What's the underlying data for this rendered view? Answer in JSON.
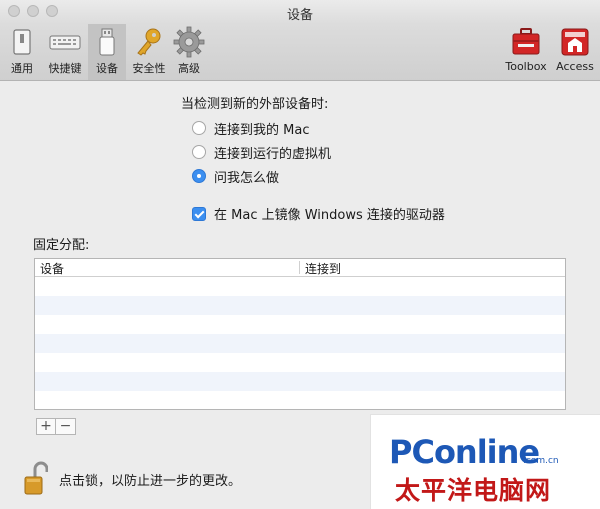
{
  "window": {
    "title": "设备"
  },
  "toolbar": {
    "items": [
      {
        "label": "通用",
        "icon": "general-switch-icon"
      },
      {
        "label": "快捷键",
        "icon": "keyboard-icon"
      },
      {
        "label": "设备",
        "icon": "usb-device-icon",
        "selected": true
      },
      {
        "label": "安全性",
        "icon": "key-icon"
      },
      {
        "label": "高级",
        "icon": "gear-icon"
      }
    ],
    "right_items": [
      {
        "label": "Toolbox",
        "icon": "toolbox-icon"
      },
      {
        "label": "Access",
        "icon": "access-icon"
      }
    ]
  },
  "content": {
    "heading": "当检测到新的外部设备时:",
    "radio_options": [
      {
        "label": "连接到我的 Mac",
        "checked": false
      },
      {
        "label": "连接到运行的虚拟机",
        "checked": false
      },
      {
        "label": "问我怎么做",
        "checked": true
      }
    ],
    "mirror_checkbox": {
      "label": "在 Mac 上镜像 Windows 连接的驱动器",
      "checked": true
    },
    "fixed_assign_label": "固定分配:",
    "table": {
      "columns": [
        "设备",
        "连接到"
      ],
      "rows": []
    },
    "add_button": "+",
    "remove_button": "−",
    "lock_text": "点击锁，以防止进一步的更改。"
  },
  "watermark": {
    "brand": "PConline",
    "domain": ".com.cn",
    "subtitle": "太平洋电脑网"
  },
  "colors": {
    "accent": "#3c8ff0",
    "watermark_blue": "#1d58b6",
    "watermark_red": "#c21818"
  }
}
